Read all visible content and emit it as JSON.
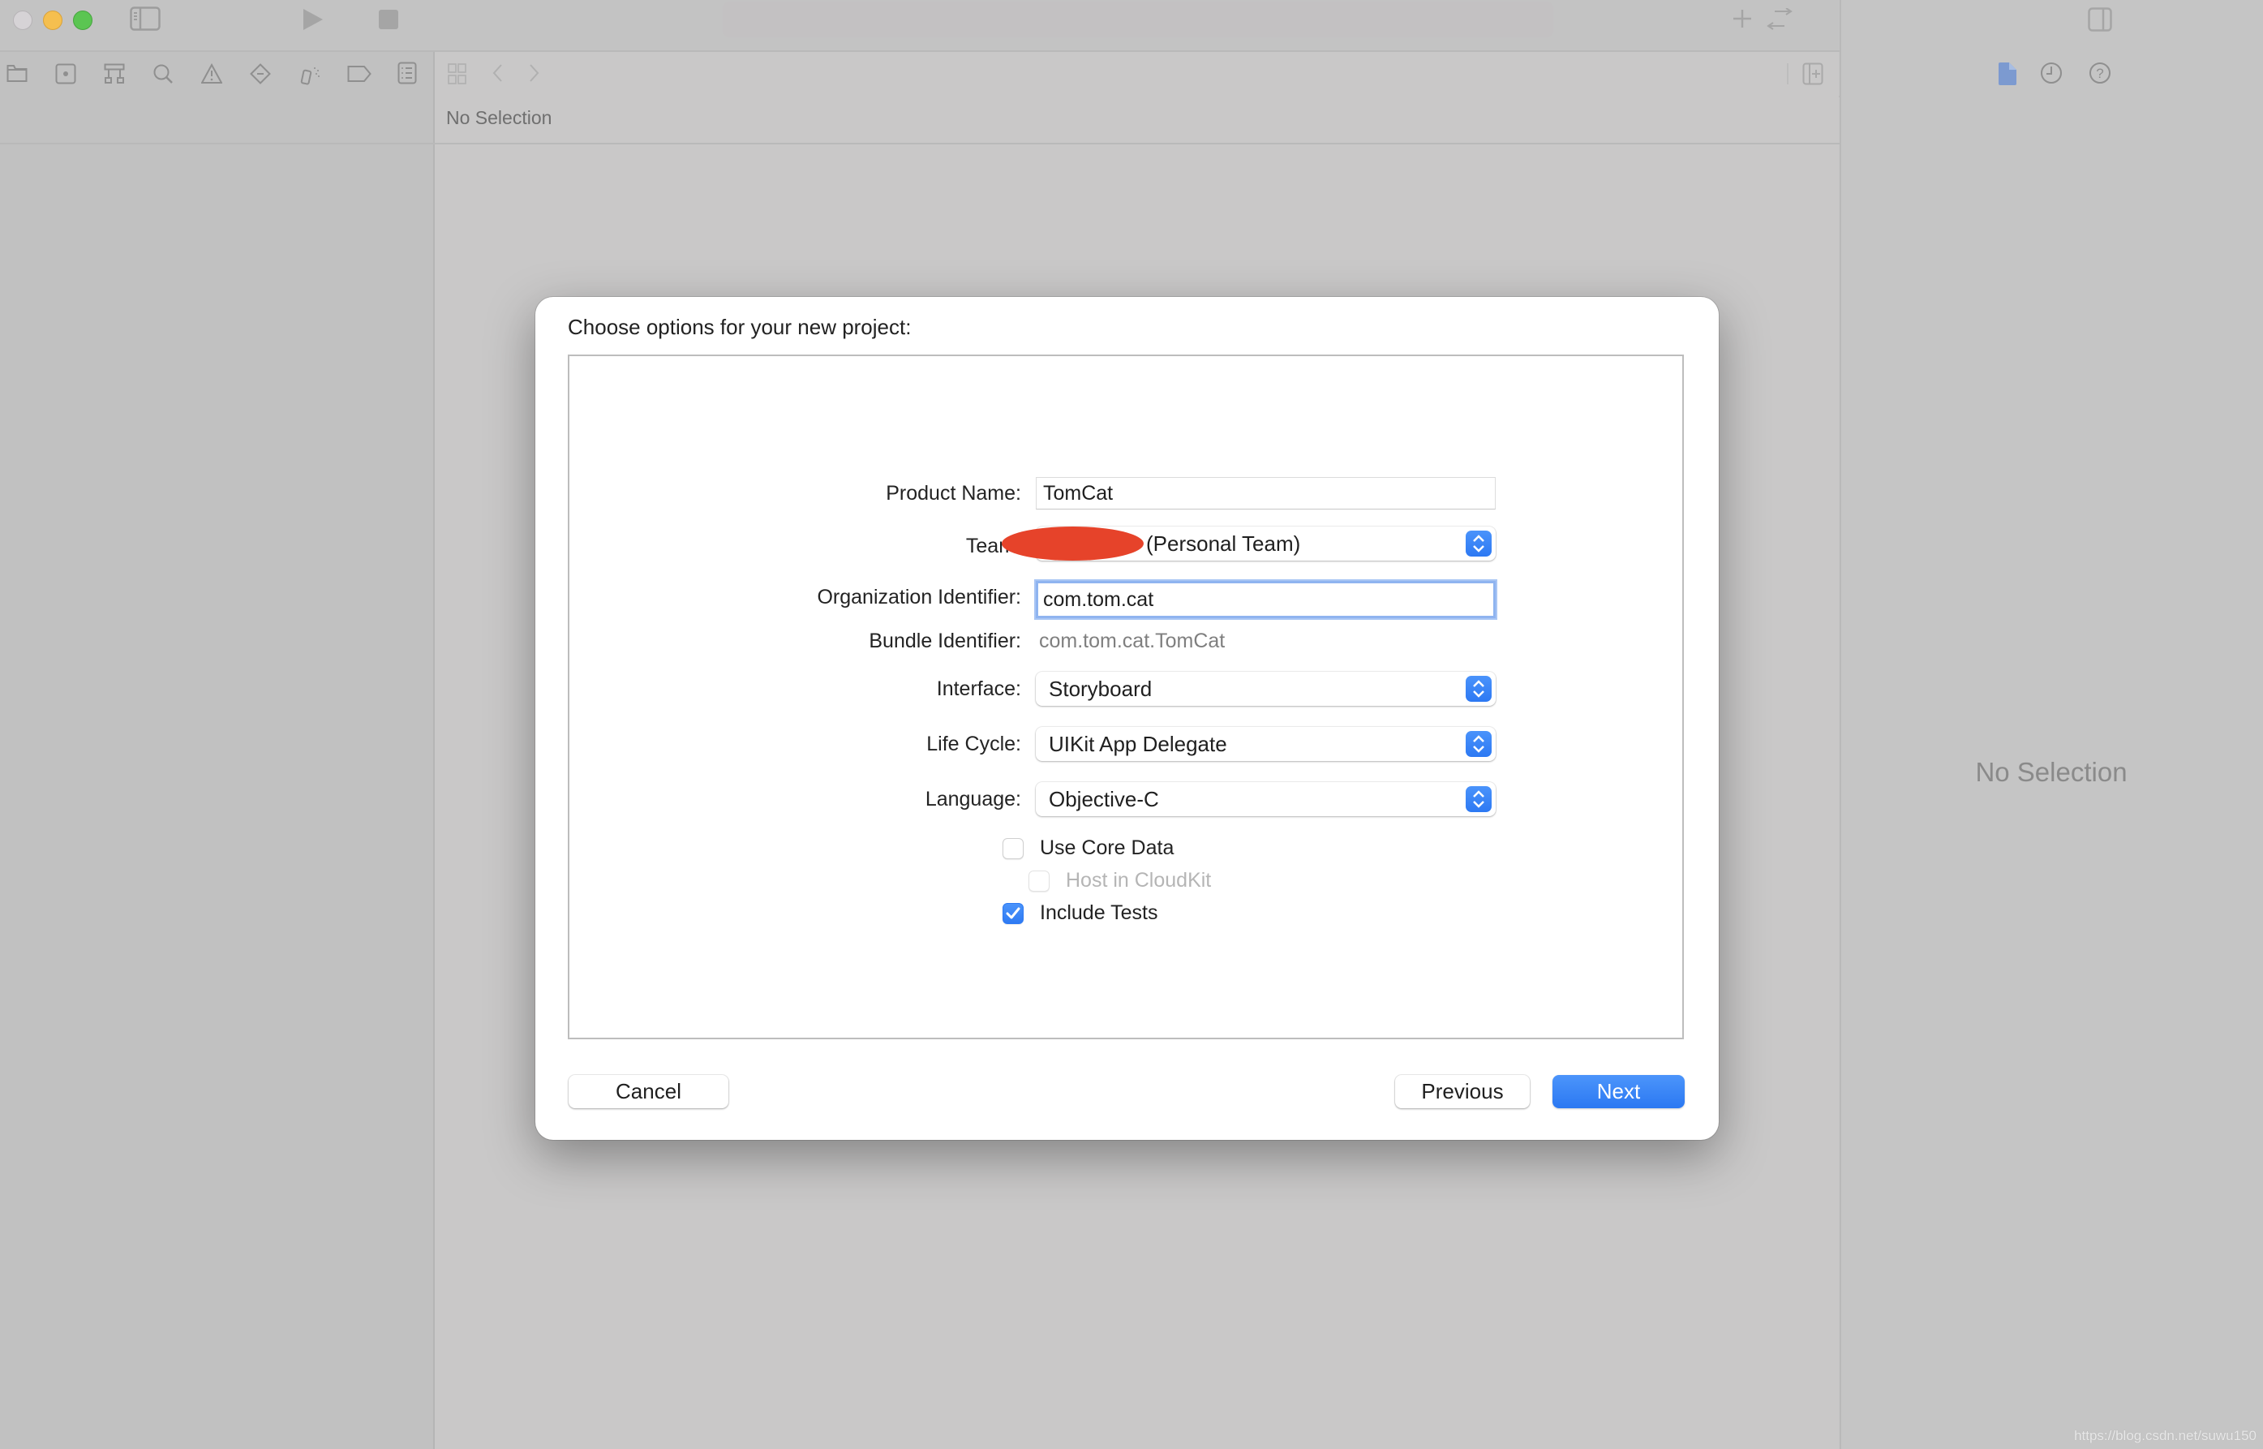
{
  "window": {
    "traffic_lights": [
      "close",
      "minimize",
      "zoom"
    ],
    "toolbar_icons": [
      "sidebar-toggle-icon",
      "run-icon",
      "stop-icon",
      "add-icon",
      "swap-icon",
      "inspector-toggle-icon"
    ],
    "navigator_icons": [
      "folder-icon",
      "source-control-icon",
      "hierarchy-icon",
      "search-icon",
      "warning-icon",
      "test-icon",
      "debug-spray-icon",
      "breakpoint-tag-icon",
      "report-icon"
    ],
    "editor_icons": [
      "grid-icon",
      "back-chevron-icon",
      "forward-chevron-icon",
      "add-editor-icon"
    ],
    "inspector_icons": [
      "file-inspector-icon",
      "history-icon",
      "help-icon"
    ]
  },
  "editor": {
    "path_text": "No Selection"
  },
  "inspector": {
    "empty_text": "No Selection"
  },
  "dialog": {
    "title": "Choose options for your new project:",
    "fields": {
      "product_name": {
        "label": "Product Name:",
        "value": "TomCat"
      },
      "team": {
        "label": "Team:",
        "value": "(Personal Team)",
        "redacted": true
      },
      "org_identifier": {
        "label": "Organization Identifier:",
        "value": "com.tom.cat",
        "focused": true
      },
      "bundle_identifier": {
        "label": "Bundle Identifier:",
        "value": "com.tom.cat.TomCat"
      },
      "interface": {
        "label": "Interface:",
        "value": "Storyboard"
      },
      "life_cycle": {
        "label": "Life Cycle:",
        "value": "UIKit App Delegate"
      },
      "language": {
        "label": "Language:",
        "value": "Objective-C"
      }
    },
    "checkboxes": [
      {
        "label": "Use Core Data",
        "checked": false,
        "enabled": true
      },
      {
        "label": "Host in CloudKit",
        "checked": false,
        "enabled": false
      },
      {
        "label": "Include Tests",
        "checked": true,
        "enabled": true
      }
    ],
    "buttons": {
      "cancel": "Cancel",
      "previous": "Previous",
      "next": "Next"
    }
  },
  "colors": {
    "accent": "#2f7bf3",
    "focus_ring": "#8fb4f0",
    "redaction": "#e6432a"
  },
  "watermark": "https://blog.csdn.net/suwu150"
}
